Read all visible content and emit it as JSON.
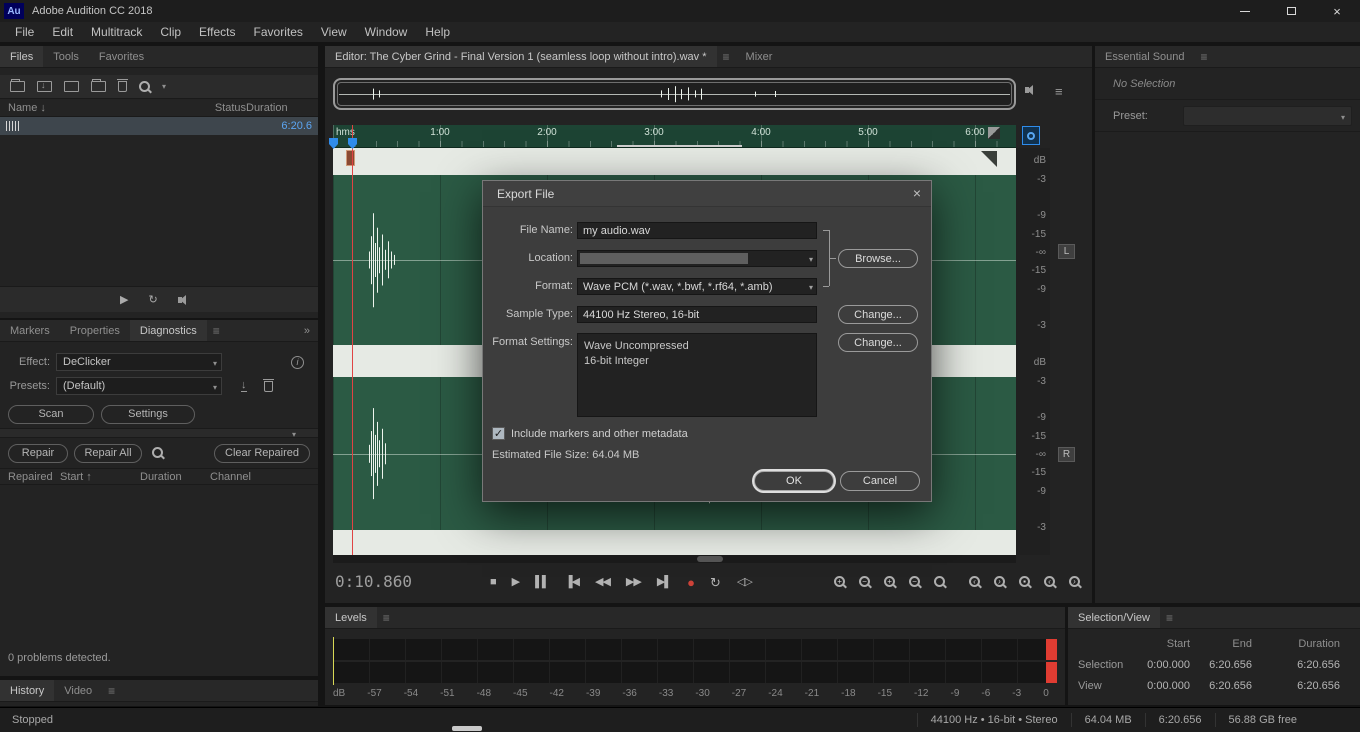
{
  "icons": {
    "panel_menu": "≡",
    "chevron_down": "▾",
    "overflow": "»",
    "close": "×",
    "search_caret": "▾",
    "info": "i",
    "download": "↓"
  },
  "titlebar": {
    "logo": "Au",
    "title": "Adobe Audition CC 2018"
  },
  "menubar": [
    {
      "label": "File",
      "name": "menu-file"
    },
    {
      "label": "Edit",
      "name": "menu-edit"
    },
    {
      "label": "Multitrack",
      "name": "menu-multitrack"
    },
    {
      "label": "Clip",
      "name": "menu-clip"
    },
    {
      "label": "Effects",
      "name": "menu-effects"
    },
    {
      "label": "Favorites",
      "name": "menu-favorites"
    },
    {
      "label": "View",
      "name": "menu-view"
    },
    {
      "label": "Window",
      "name": "menu-window"
    },
    {
      "label": "Help",
      "name": "menu-help"
    }
  ],
  "files_panel": {
    "tabs": [
      {
        "label": "Files",
        "name": "tab-files",
        "active": true
      },
      {
        "label": "Tools",
        "name": "tab-tools",
        "active": false
      },
      {
        "label": "Favorites",
        "name": "tab-favorites",
        "active": false
      }
    ],
    "columns": [
      {
        "label": "Name ↓",
        "name": "column-name"
      },
      {
        "label": "Status",
        "name": "column-status"
      },
      {
        "label": "Duration",
        "name": "column-duration"
      }
    ],
    "row": {
      "duration": "6:20.6"
    }
  },
  "diagnostics_panel": {
    "tabs": [
      {
        "label": "Markers",
        "name": "tab-markers",
        "active": false
      },
      {
        "label": "Properties",
        "name": "tab-properties",
        "active": false
      },
      {
        "label": "Diagnostics",
        "name": "tab-diagnostics",
        "active": true
      }
    ],
    "effect_label": "Effect:",
    "effect_value": "DeClicker",
    "presets_label": "Presets:",
    "presets_value": "(Default)",
    "scan_button": "Scan",
    "settings_button": "Settings",
    "repair_button": "Repair",
    "repair_all_button": "Repair All",
    "clear_repaired_button": "Clear Repaired",
    "columns": [
      {
        "label": "Repaired",
        "name": "column-repaired"
      },
      {
        "label": "Start ↑",
        "name": "column-start"
      },
      {
        "label": "Duration",
        "name": "column-duration"
      },
      {
        "label": "Channel",
        "name": "column-channel"
      }
    ],
    "status": "0 problems detected."
  },
  "history_bar": {
    "tabs": [
      {
        "label": "History",
        "name": "tab-history",
        "active": true
      },
      {
        "label": "Video",
        "name": "tab-video",
        "active": false
      }
    ]
  },
  "statusbar": {
    "left": "Stopped",
    "right": [
      {
        "label": "44100 Hz • 16-bit • Stereo",
        "name": "status-sample-info"
      },
      {
        "label": "64.04 MB",
        "name": "status-file-size"
      },
      {
        "label": "6:20.656",
        "name": "status-duration"
      },
      {
        "label": "56.88 GB free",
        "name": "status-free-space"
      }
    ]
  },
  "editor": {
    "tab_label": "Editor: The Cyber Grind - Final Version 1 (seamless loop without intro).wav *",
    "mixer_tab": "Mixer",
    "ruler_labels": [
      "hms",
      "1:00",
      "2:00",
      "3:00",
      "4:00",
      "5:00",
      "6:00"
    ],
    "db_labels": [
      "dB",
      "-3",
      "-9",
      "-15",
      "-∞",
      "-15",
      "-9",
      "-3"
    ],
    "channel_badges": {
      "left": "L",
      "right": "R"
    },
    "time_display": "0:10.860",
    "transport_buttons": [
      {
        "name": "stop-button",
        "glyph": "■"
      },
      {
        "name": "play-button",
        "glyph": "▶"
      },
      {
        "name": "pause-button",
        "glyph": "▌▌"
      },
      {
        "name": "skip-to-start-button",
        "glyph": "▐◀"
      },
      {
        "name": "rewind-button",
        "glyph": "◀◀"
      },
      {
        "name": "fast-forward-button",
        "glyph": "▶▶"
      },
      {
        "name": "skip-to-end-button",
        "glyph": "▶▌"
      },
      {
        "name": "record-button",
        "glyph": "●"
      },
      {
        "name": "loop-playback-button",
        "glyph": "↻"
      },
      {
        "name": "skip-selection-button",
        "glyph": "◁▷"
      }
    ],
    "zoom_buttons": [
      {
        "name": "zoom-in-time-button",
        "sym": "+"
      },
      {
        "name": "zoom-out-time-button",
        "sym": "−"
      },
      {
        "name": "zoom-in-amplitude-button",
        "sym": "+"
      },
      {
        "name": "zoom-out-amplitude-button",
        "sym": "−"
      },
      {
        "name": "zoom-reset-button",
        "sym": ""
      },
      {
        "name": "zoom-in-at-in-point-button",
        "sym": "‹"
      },
      {
        "name": "zoom-in-at-out-point-button",
        "sym": "›"
      },
      {
        "name": "zoom-to-selection-button",
        "sym": "▪"
      },
      {
        "name": "zoom-left-button",
        "sym": "‹"
      },
      {
        "name": "zoom-right-button",
        "sym": "›"
      }
    ],
    "waveform": {
      "left": [
        [
          0.052,
          0.1
        ],
        [
          0.056,
          0.28
        ],
        [
          0.059,
          0.55
        ],
        [
          0.062,
          0.2
        ],
        [
          0.065,
          0.38
        ],
        [
          0.068,
          0.15
        ],
        [
          0.072,
          0.3
        ],
        [
          0.076,
          0.12
        ],
        [
          0.08,
          0.22
        ],
        [
          0.085,
          0.1
        ],
        [
          0.09,
          0.06
        ],
        [
          0.52,
          0.05
        ],
        [
          0.53,
          0.04
        ]
      ],
      "right": [
        [
          0.052,
          0.12
        ],
        [
          0.056,
          0.3
        ],
        [
          0.059,
          0.6
        ],
        [
          0.062,
          0.25
        ],
        [
          0.065,
          0.42
        ],
        [
          0.068,
          0.18
        ],
        [
          0.072,
          0.33
        ],
        [
          0.076,
          0.14
        ],
        [
          0.52,
          0.3
        ],
        [
          0.53,
          0.52
        ],
        [
          0.535,
          0.25
        ],
        [
          0.54,
          0.4
        ],
        [
          0.55,
          0.65
        ],
        [
          0.555,
          0.3
        ],
        [
          0.56,
          0.45
        ],
        [
          0.57,
          0.25
        ],
        [
          0.58,
          0.38
        ],
        [
          0.59,
          0.18
        ],
        [
          0.6,
          0.28
        ],
        [
          0.61,
          0.15
        ],
        [
          0.62,
          0.22
        ],
        [
          0.63,
          0.12
        ],
        [
          0.64,
          0.18
        ]
      ],
      "overview": [
        [
          0.05,
          0.45
        ],
        [
          0.06,
          0.3
        ],
        [
          0.48,
          0.3
        ],
        [
          0.49,
          0.5
        ],
        [
          0.5,
          0.65
        ],
        [
          0.51,
          0.4
        ],
        [
          0.52,
          0.55
        ],
        [
          0.53,
          0.3
        ],
        [
          0.54,
          0.45
        ],
        [
          0.62,
          0.2
        ],
        [
          0.65,
          0.25
        ]
      ]
    }
  },
  "levels_panel": {
    "title": "Levels",
    "db_ticks": [
      "dB",
      "-57",
      "-54",
      "-51",
      "-48",
      "-45",
      "-42",
      "-39",
      "-36",
      "-33",
      "-30",
      "-27",
      "-24",
      "-21",
      "-18",
      "-15",
      "-12",
      "-9",
      "-6",
      "-3",
      "0"
    ]
  },
  "essential_sound": {
    "title": "Essential Sound",
    "empty_text": "No Selection",
    "preset_label": "Preset:"
  },
  "selection_view": {
    "title": "Selection/View",
    "columns": [
      "Start",
      "End",
      "Duration"
    ],
    "rows": [
      {
        "name": "selection-row",
        "label": "Selection",
        "start": "0:00.000",
        "end": "6:20.656",
        "duration": "6:20.656"
      },
      {
        "name": "view-row",
        "label": "View",
        "start": "0:00.000",
        "end": "6:20.656",
        "duration": "6:20.656"
      }
    ]
  },
  "export_dialog": {
    "title": "Export File",
    "file_name_label": "File Name:",
    "file_name_value": "my audio.wav",
    "location_label": "Location:",
    "browse_button": "Browse...",
    "format_label": "Format:",
    "format_value": "Wave PCM (*.wav, *.bwf, *.rf64, *.amb)",
    "sample_type_label": "Sample Type:",
    "sample_type_value": "44100 Hz Stereo, 16-bit",
    "sample_change_button": "Change...",
    "format_settings_label": "Format Settings:",
    "format_settings_value": "Wave Uncompressed\n16-bit Integer",
    "format_change_button": "Change...",
    "checkbox_label": "Include markers and other metadata",
    "checkbox_glyph": "✓",
    "estimated_text": "Estimated File Size: 64.04 MB",
    "ok_button": "OK",
    "cancel_button": "Cancel"
  }
}
